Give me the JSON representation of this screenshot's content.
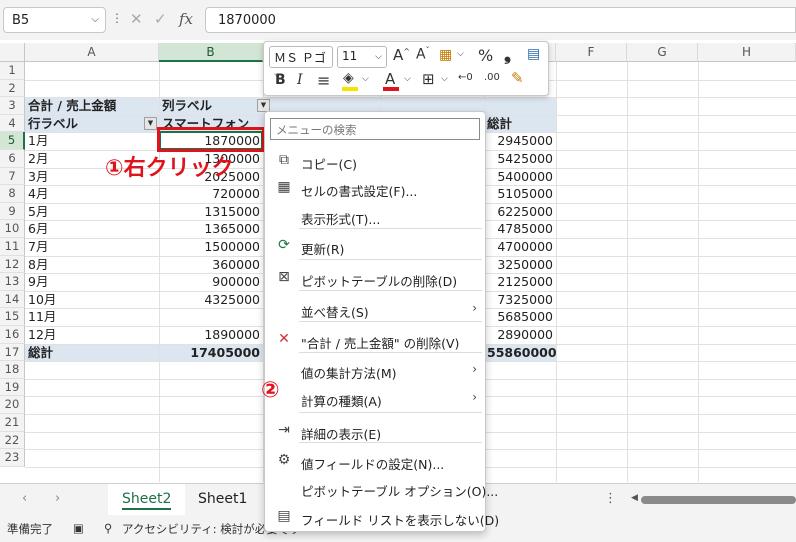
{
  "formula_bar": {
    "name_box": "B5",
    "cancel_glyph": "✕",
    "enter_glyph": "✓",
    "fx_glyph": "fx",
    "formula_value": "1870000"
  },
  "columns": [
    "A",
    "B",
    "C",
    "D",
    "E",
    "F",
    "G",
    "H"
  ],
  "rows": [
    "1",
    "2",
    "3",
    "4",
    "5",
    "6",
    "7",
    "8",
    "9",
    "10",
    "11",
    "12",
    "13",
    "14",
    "15",
    "16",
    "17",
    "18",
    "19",
    "20",
    "21",
    "22",
    "23"
  ],
  "pivot": {
    "value_header": "合計 / 売上金額",
    "column_label": "列ラベル",
    "row_label": "行ラベル",
    "col_b_header": "スマートフォン",
    "grand_total_col_header": "総計",
    "months": [
      "1月",
      "2月",
      "3月",
      "4月",
      "5月",
      "6月",
      "7月",
      "8月",
      "9月",
      "10月",
      "11月",
      "12月"
    ],
    "b_values": [
      "1870000",
      "1300000",
      "2025000",
      "720000",
      "1315000",
      "1365000",
      "1500000",
      "360000",
      "900000",
      "4325000",
      "",
      "1890000"
    ],
    "total_values": [
      "2945000",
      "5425000",
      "5400000",
      "5105000",
      "6225000",
      "4785000",
      "4700000",
      "3250000",
      "2125000",
      "7325000",
      "5685000",
      "2890000"
    ],
    "grand_total_label": "総計",
    "grand_total_b": "17405000",
    "grand_total": "55860000"
  },
  "annotations": {
    "step1": "①右クリック",
    "step2": "②"
  },
  "mini_toolbar": {
    "font_name": "ＭＳ Ｐゴ",
    "font_size": "11",
    "bold": "B",
    "italic": "I",
    "align": "≡",
    "percent": "%",
    "comma": "❟",
    "colors": {
      "highlight": "#f5e300",
      "font": "#e0121c"
    }
  },
  "context_menu": {
    "search_placeholder": "メニューの検索",
    "items": [
      {
        "label": "コピー(C)",
        "icon": "copy-icon"
      },
      {
        "label": "セルの書式設定(F)...",
        "icon": "format-cells-icon"
      },
      {
        "label": "表示形式(T)...",
        "icon": ""
      },
      {
        "label": "更新(R)",
        "icon": "refresh-icon"
      },
      {
        "label": "ピボットテーブルの削除(D)",
        "icon": "delete-pivot-icon"
      },
      {
        "label": "並べ替え(S)",
        "icon": "",
        "submenu": true
      },
      {
        "label": "\"合計 / 売上金額\" の削除(V)",
        "icon": "remove-icon"
      },
      {
        "label": "値の集計方法(M)",
        "icon": "",
        "submenu": true
      },
      {
        "label": "計算の種類(A)",
        "icon": "",
        "submenu": true
      },
      {
        "label": "詳細の表示(E)",
        "icon": "show-details-icon"
      },
      {
        "label": "値フィールドの設定(N)...",
        "icon": "field-settings-icon"
      },
      {
        "label": "ピボットテーブル オプション(O)...",
        "icon": ""
      },
      {
        "label": "フィールド リストを表示しない(D)",
        "icon": "field-list-icon"
      }
    ]
  },
  "sheet_tabs": [
    "Sheet2",
    "Sheet1"
  ],
  "status_bar": {
    "ready": "準備完了",
    "accessibility": "アクセシビリティ: 検討が必要です"
  }
}
